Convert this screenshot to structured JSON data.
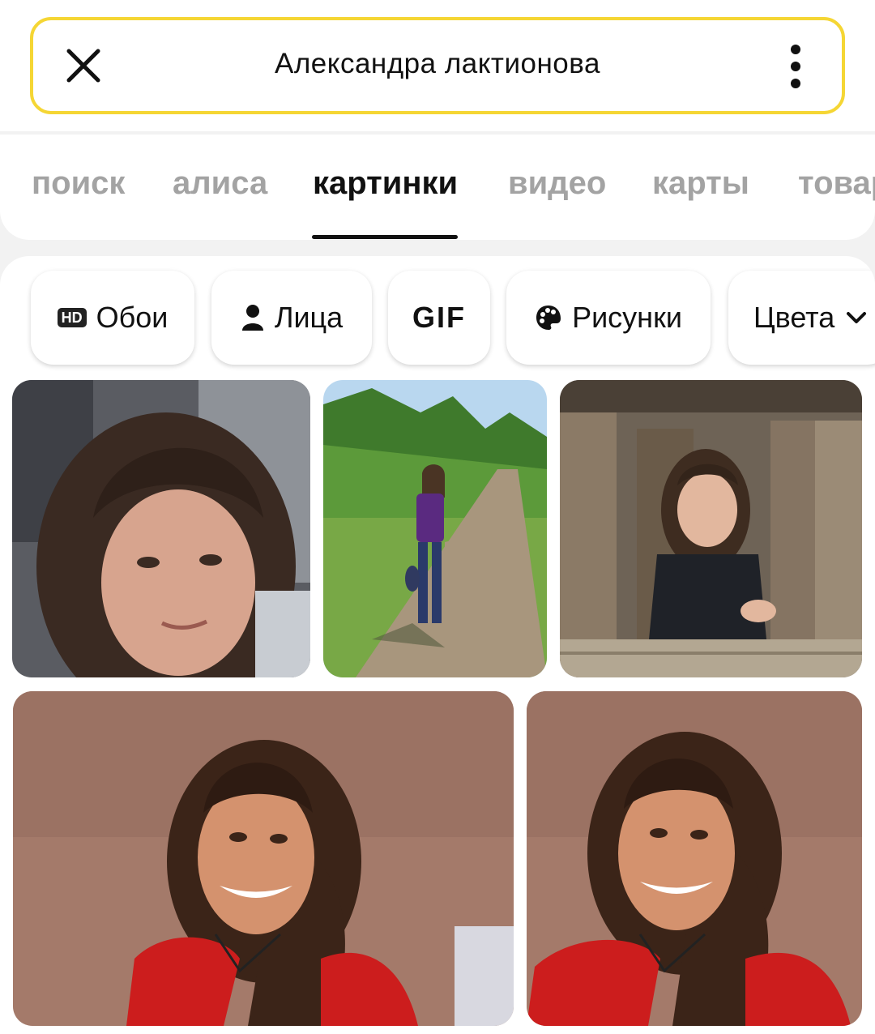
{
  "search": {
    "query": "Александра лактионова",
    "close_icon": "close-icon",
    "more_icon": "more-vertical-icon",
    "border_color": "#f5d634"
  },
  "tabs": [
    {
      "label": "поиск",
      "active": false
    },
    {
      "label": "алиса",
      "active": false
    },
    {
      "label": "картинки",
      "active": true
    },
    {
      "label": "видео",
      "active": false
    },
    {
      "label": "карты",
      "active": false
    },
    {
      "label": "товары",
      "active": false
    }
  ],
  "filters": [
    {
      "label": "Обои",
      "icon": "hd-icon",
      "badge": "HD"
    },
    {
      "label": "Лица",
      "icon": "person-icon"
    },
    {
      "label": "GIF"
    },
    {
      "label": "Рисунки",
      "icon": "palette-icon"
    },
    {
      "label": "Цвета",
      "icon": "chevron-down-icon"
    }
  ],
  "images": [
    {
      "description_icon": "image-thumbnail"
    },
    {
      "description_icon": "image-thumbnail"
    },
    {
      "description_icon": "image-thumbnail"
    },
    {
      "description_icon": "image-thumbnail"
    },
    {
      "description_icon": "image-thumbnail"
    }
  ]
}
